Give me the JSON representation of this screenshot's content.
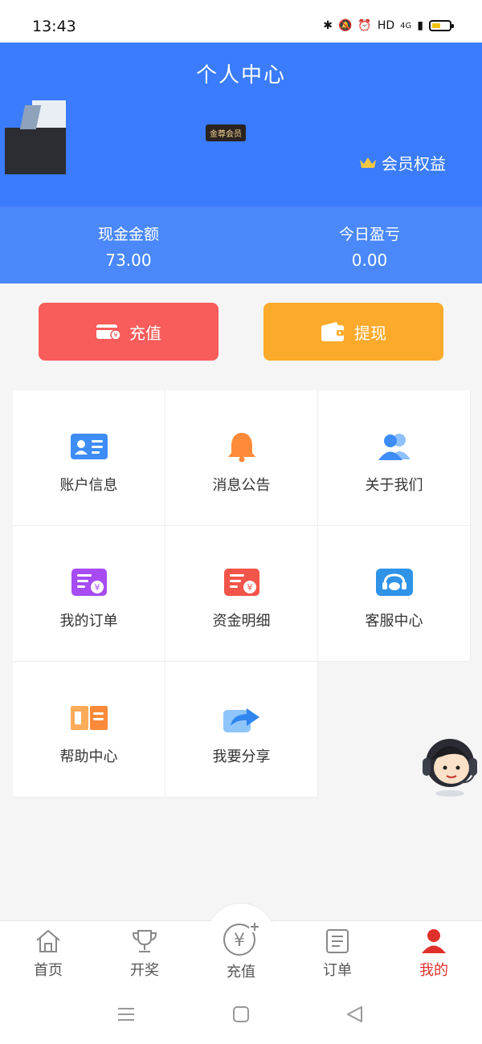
{
  "status_bar": {
    "time": "13:43",
    "network": "HD",
    "signal": "4G"
  },
  "header": {
    "title": "个人中心",
    "member_badge": "金尊会员",
    "benefits_label": "会员权益"
  },
  "stats": {
    "cash_label": "现金金额",
    "cash_value": "73.00",
    "today_label": "今日盈亏",
    "today_value": "0.00"
  },
  "actions": {
    "recharge": "充值",
    "withdraw": "提现"
  },
  "grid": {
    "account_info": "账户信息",
    "notices": "消息公告",
    "about_us": "关于我们",
    "my_orders": "我的订单",
    "fund_details": "资金明细",
    "customer_service": "客服中心",
    "help_center": "帮助中心",
    "share": "我要分享"
  },
  "tabs": {
    "home": "首页",
    "lottery": "开奖",
    "recharge": "充值",
    "orders": "订单",
    "mine": "我的",
    "active": "我的"
  },
  "colors": {
    "header_blue": "#3a7cfb",
    "stats_blue": "#4a88fb",
    "recharge_red": "#f85c5b",
    "withdraw_orange": "#fcaa2b",
    "active_tab": "#e0302c"
  }
}
